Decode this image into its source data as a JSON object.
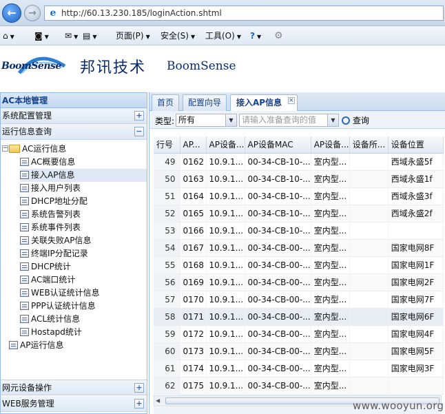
{
  "browser": {
    "url": "http://60.13.230.185/loginAction.shtml",
    "menu": {
      "page": "页面(P)",
      "safety": "安全(S)",
      "tools": "工具(O)"
    }
  },
  "header": {
    "logo": "BoomSense",
    "brand_cn": "邦讯技术",
    "brand_en": "BoomSense"
  },
  "sidebar": {
    "title": "AC本地管理",
    "sections": [
      {
        "label": "系统配置管理",
        "toggle": "+"
      },
      {
        "label": "运行信息查询",
        "toggle": "−"
      }
    ],
    "tree": {
      "root_label": "AC运行信息",
      "items": [
        "AC概要信息",
        "接入AP信息",
        "接入用户列表",
        "DHCP地址分配",
        "系统告警列表",
        "系统事件列表",
        "关联失败AP信息",
        "终端IP分配记录",
        "DHCP统计",
        "AC端口统计",
        "WEB认证统计信息",
        "PPP认证统计信息",
        "ACL统计信息",
        "Hostapd统计"
      ],
      "selected_index": 1,
      "ap_root_label": "AP运行信息"
    },
    "bottom_sections": [
      {
        "label": "网元设备操作",
        "toggle": "+"
      },
      {
        "label": "WEB服务管理",
        "toggle": "+"
      }
    ]
  },
  "tabs": {
    "home": "首页",
    "wizard": "配置向导",
    "active": "接入AP信息",
    "close": "×"
  },
  "filter": {
    "type_label": "类型:",
    "type_value": "所有",
    "query_placeholder": "请输入准备查询的值",
    "query_button": "查询"
  },
  "grid": {
    "columns": [
      "行号",
      "AP...",
      "AP设备...",
      "AP设备MAC",
      "AP设备...",
      "设备所...",
      "设备位置"
    ],
    "rows": [
      [
        "49",
        "0162",
        "10.9.1...",
        "00-34-CB-10-...",
        "室内型...",
        "",
        "西域永盛5f"
      ],
      [
        "50",
        "0163",
        "10.9.1...",
        "00-34-CB-10-...",
        "室内型...",
        "",
        "西域永盛1f"
      ],
      [
        "51",
        "0164",
        "10.9.1...",
        "00-34-CB-10-...",
        "室内型...",
        "",
        "西域永盛3f"
      ],
      [
        "52",
        "0165",
        "10.9.1...",
        "00-34-CB-10-...",
        "室内型...",
        "",
        "西域永盛2f"
      ],
      [
        "53",
        "0166",
        "10.9.1...",
        "00-34-CB-10-...",
        "室内型...",
        "",
        ""
      ],
      [
        "54",
        "0167",
        "10.9.1...",
        "00-34-CB-00-...",
        "室内型...",
        "",
        "国家电网8F"
      ],
      [
        "55",
        "0168",
        "10.9.1...",
        "00-34-CB-00-...",
        "室内型...",
        "",
        "国家电网1F"
      ],
      [
        "56",
        "0169",
        "10.9.1...",
        "00-34-CB-00-...",
        "室内型...",
        "",
        "国家电网2F"
      ],
      [
        "57",
        "0170",
        "10.9.1...",
        "00-34-CB-00-...",
        "室内型...",
        "",
        "国家电网7F"
      ],
      [
        "58",
        "0171",
        "10.9.1...",
        "00-34-CB-00-...",
        "室内型...",
        "",
        "国家电网6F"
      ],
      [
        "59",
        "0172",
        "10.9.1...",
        "00-34-CB-00-...",
        "室内型...",
        "",
        "国家电网4F"
      ],
      [
        "60",
        "0173",
        "10.9.1...",
        "00-34-CB-00-...",
        "室内型...",
        "",
        "国家电网5F"
      ],
      [
        "61",
        "0174",
        "10.9.1...",
        "00-34-CB-00-...",
        "室内型...",
        "",
        "国家电网3F"
      ],
      [
        "62",
        "0175",
        "10.9.1...",
        "00-34-CB-00-...",
        "室内型...",
        "",
        ""
      ]
    ],
    "highlight_row": 9
  },
  "watermark": "www.wooyun.org"
}
